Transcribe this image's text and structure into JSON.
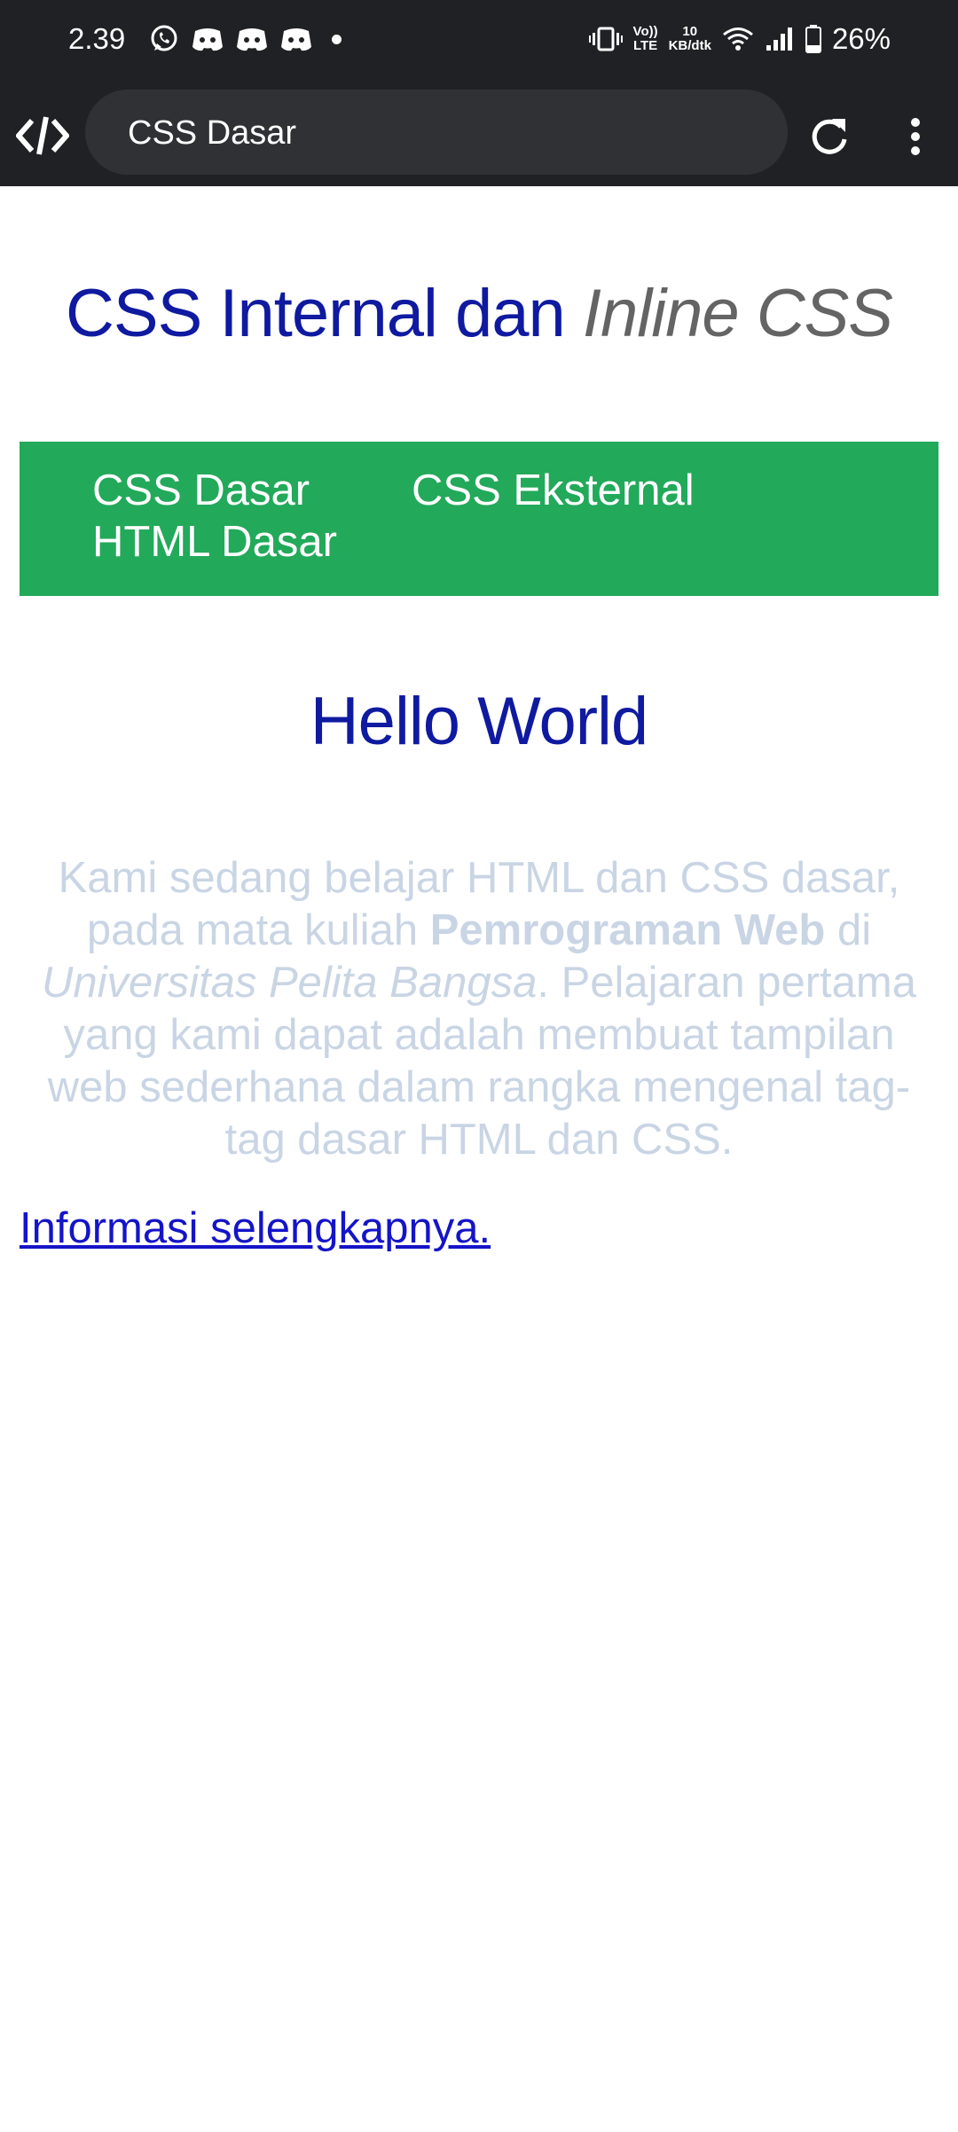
{
  "status_bar": {
    "time": "2.39",
    "notification_icons": [
      "whatsapp-icon",
      "discord-icon",
      "discord-icon",
      "discord-icon",
      "dot-icon"
    ],
    "volte_label": [
      "Vo))",
      "LTE"
    ],
    "speed_value": "10",
    "speed_unit": "KB/dtk",
    "battery_percent": "26%"
  },
  "browser": {
    "tab_title": "CSS Dasar",
    "site_icon": "code-icon",
    "reload_icon": "reload-icon",
    "menu_icon": "kebab-menu-icon"
  },
  "page": {
    "title_main": "CSS Internal dan ",
    "title_italic": "Inline CSS",
    "nav": [
      "CSS Dasar",
      "CSS Eksternal",
      "HTML Dasar"
    ],
    "heading": "Hello World",
    "paragraph": {
      "part1": "Kami sedang belajar HTML dan CSS dasar, pada mata kuliah ",
      "bold": "Pemrograman Web",
      "part2": " di ",
      "italic": "Universitas Pelita Bangsa",
      "part3": ". Pelajaran pertama yang kami dapat adalah membuat tampilan web sederhana dalam rangka mengenal tag-tag dasar HTML dan CSS."
    },
    "more_link": "Informasi selengkapnya."
  },
  "colors": {
    "heading": "#0f1aa0",
    "italic_title": "#646464",
    "nav_bg": "#22a95a",
    "paragraph": "#c9d5e4",
    "link": "#1414c8",
    "chrome_bg": "#202124",
    "url_bg": "#303134"
  }
}
